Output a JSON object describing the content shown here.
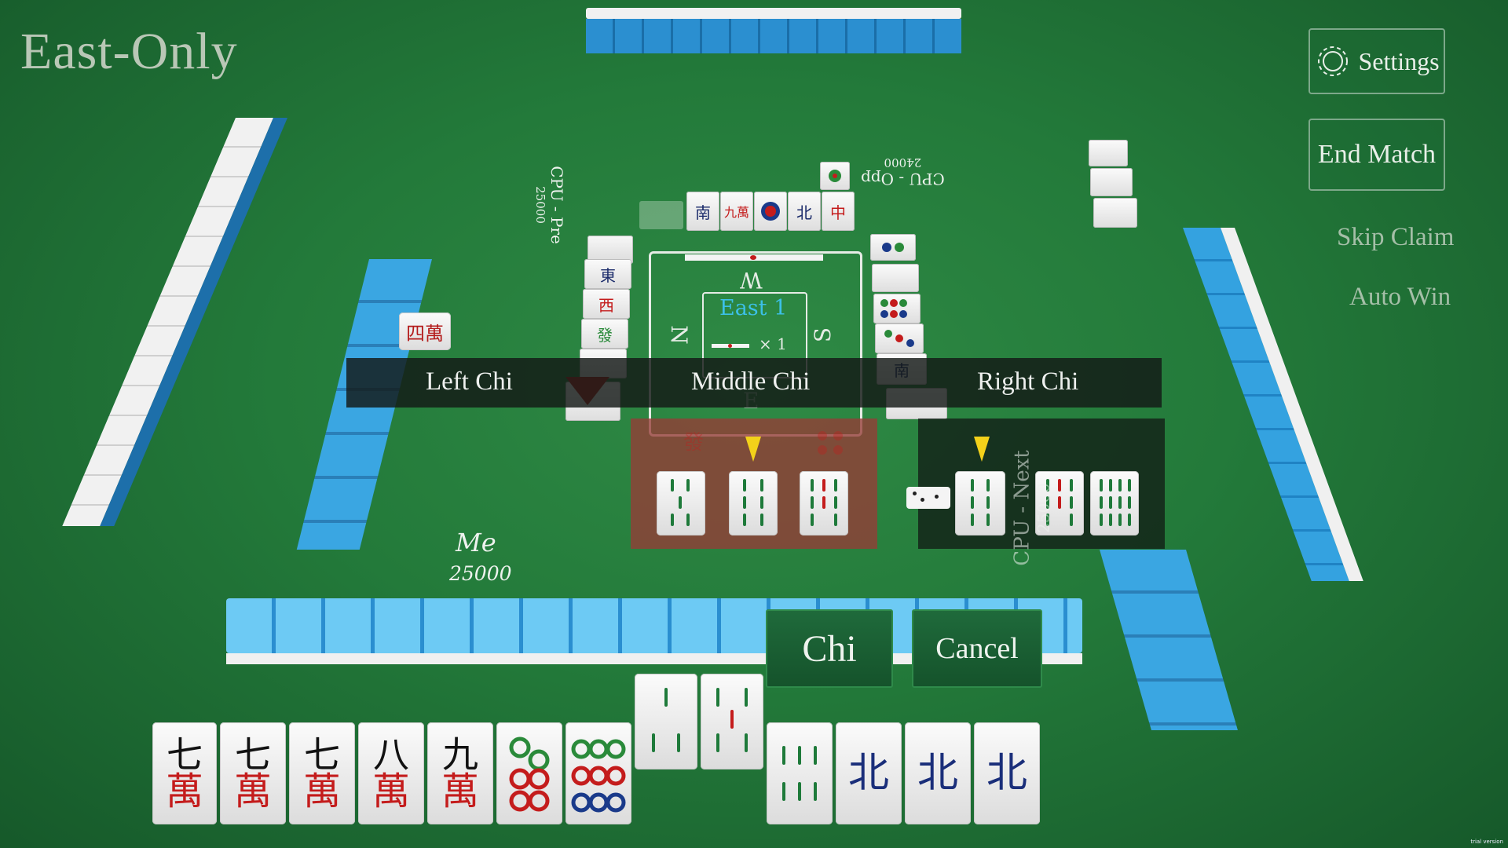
{
  "mode_label": "East-Only",
  "menu": {
    "settings": "Settings",
    "end_match": "End Match",
    "skip_claim": "Skip Claim",
    "auto_win": "Auto Win"
  },
  "players": {
    "me": {
      "name": "Me",
      "score": "25000"
    },
    "left": {
      "name": "CPU - Pre",
      "score": "25000"
    },
    "top": {
      "name": "CPU - Opp",
      "score": "24000"
    },
    "right": {
      "name": "CPU - Next",
      "score": "25000"
    }
  },
  "board": {
    "round": "East 1",
    "honba": "× 1",
    "wind_top": "W",
    "wind_left": "N",
    "wind_right": "S",
    "wind_bottom": "E"
  },
  "claim_options": {
    "left": "Left Chi",
    "middle": "Middle Chi",
    "right": "Right Chi"
  },
  "actions": {
    "chi": "Chi",
    "cancel": "Cancel"
  },
  "hand": [
    {
      "num": "七",
      "suit": "萬"
    },
    {
      "num": "七",
      "suit": "萬"
    },
    {
      "num": "七",
      "suit": "萬"
    },
    {
      "num": "八",
      "suit": "萬"
    },
    {
      "num": "九",
      "suit": "萬"
    }
  ],
  "hand_winds": [
    "北",
    "北",
    "北"
  ],
  "left_discards": [
    "東",
    "西",
    "發"
  ],
  "top_discards": [
    "中",
    "北",
    "南",
    "九萬"
  ],
  "right_discard_wind": "南",
  "trial": "trial version",
  "colors": {
    "table": "#237a3a",
    "tile_back": "#2a9ad8",
    "highlight": "#f3d11a"
  }
}
